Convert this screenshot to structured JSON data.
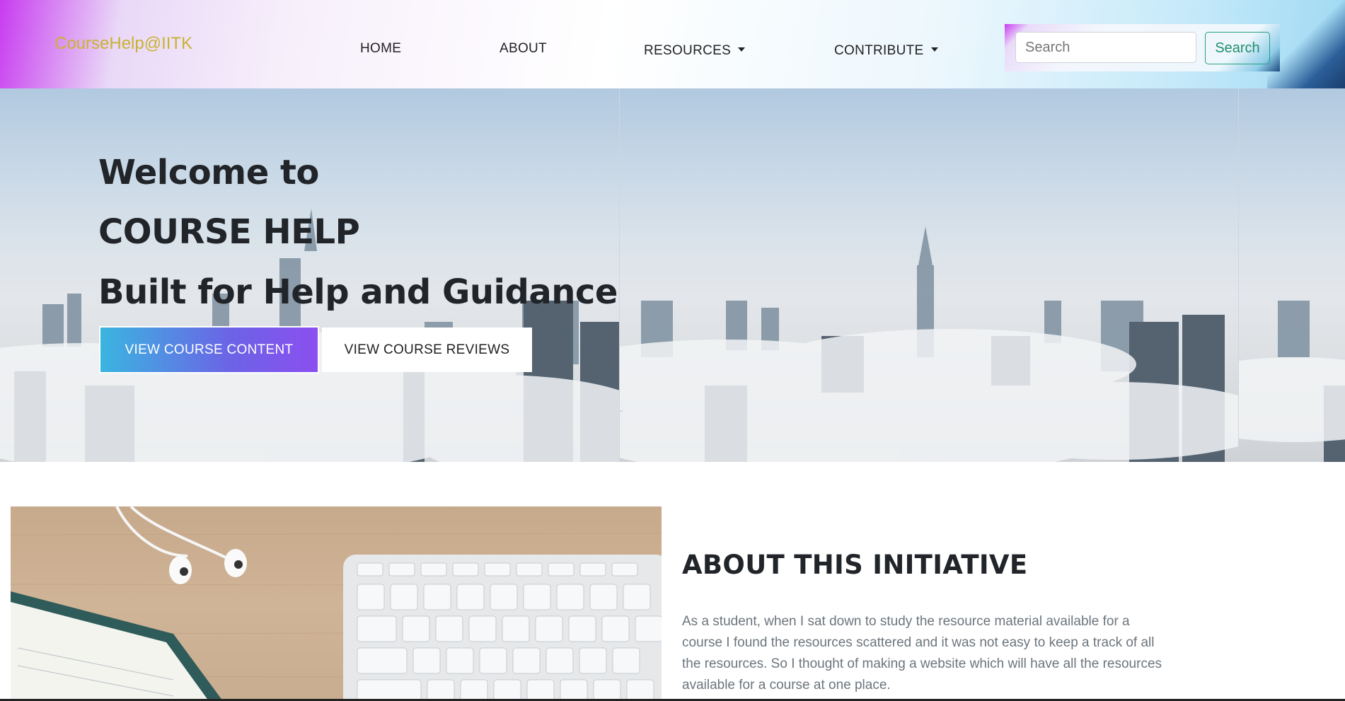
{
  "navbar": {
    "brand": "CourseHelp@IITK",
    "links": {
      "home": "HOME",
      "about": "ABOUT",
      "resources": "RESOURCES",
      "contribute": "CONTRIBUTE"
    },
    "search": {
      "placeholder": "Search",
      "button_label": "Search"
    },
    "colors": {
      "brand_text": "#c9b233",
      "search_button": "#1f8e6c"
    }
  },
  "hero": {
    "line1": "Welcome to",
    "line2": "COURSE HELP",
    "line3": "Built for Help and Guidance",
    "primary_button": "VIEW COURSE CONTENT",
    "secondary_button": "VIEW COURSE REVIEWS",
    "background": "foggy-city-skyline-image",
    "colors": {
      "primary_gradient_start": "#3ab5e0",
      "primary_gradient_end": "#8b4ff0"
    }
  },
  "about": {
    "title": "ABOUT THIS INITIATIVE",
    "text": "As a student, when I sat down to study the resource material available for a course I found the resources scattered and it was not easy to keep a track of all the resources. So I thought of making a website which will have all the resources available for a course at one place.",
    "image": "desk-keyboard-earphones-notebook-image"
  }
}
